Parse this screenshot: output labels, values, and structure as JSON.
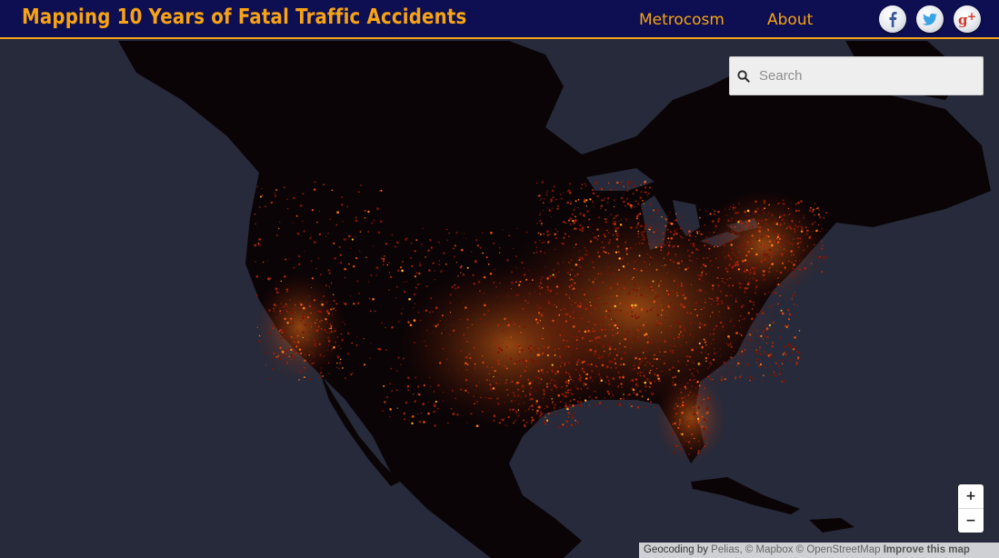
{
  "header": {
    "title": "Mapping 10 Years of Fatal Traffic Accidents",
    "nav": [
      {
        "label": "Metrocosm"
      },
      {
        "label": "About"
      }
    ],
    "social": [
      "facebook-icon",
      "twitter-icon",
      "google-plus-icon"
    ]
  },
  "search": {
    "placeholder": "Search",
    "value": ""
  },
  "zoom": {
    "in_label": "+",
    "out_label": "−"
  },
  "attribution": {
    "prefix": "Geocoding by ",
    "pelias": "Pelias",
    "mapbox": ", © Mapbox © OpenStreetMap ",
    "improve": "Improve this map"
  },
  "colors": {
    "header_bg": "#0d0f52",
    "accent": "#f7a316",
    "ocean": "#262a3a",
    "land": "#0b0406",
    "heat_low": "#8a1a05",
    "heat_mid": "#ff6a10",
    "heat_high": "#ffd24a"
  }
}
